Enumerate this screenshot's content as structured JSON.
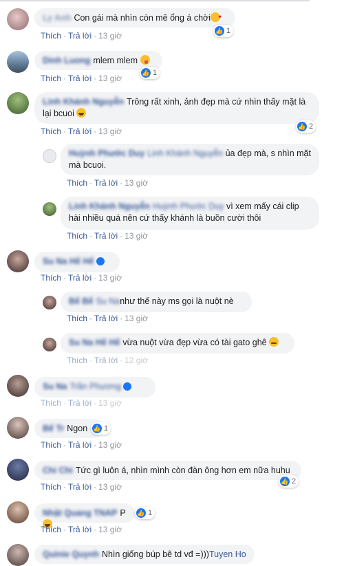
{
  "actions": {
    "like": "Thích",
    "reply": "Trả lời",
    "sep": "·"
  },
  "comments": [
    {
      "author": "Ly Anh",
      "text": "Con gái mà nhìn còn mê ổng á chời",
      "emoji": "love",
      "reactions": "1",
      "time": "13 giờ"
    },
    {
      "author": "Dinh Luong",
      "text": "mlem mlem",
      "emoji": "tongue",
      "reactions": "1",
      "time": "13 giờ"
    },
    {
      "author": "Linh Khánh Nguyễn",
      "text": "Trông rất xinh, ảnh đẹp mà cứ nhìn thấy mặt là lại bcuoi",
      "emoji": "laugh",
      "reactions": "2",
      "time": "13 giờ"
    },
    {
      "author": "Huỳnh Phước Duy",
      "mention": "Linh Khánh Nguyễn",
      "text": "ủa đẹp mà, s nhìn mặt mà bcuoi.",
      "time": "13 giờ"
    },
    {
      "author": "Linh Khánh Nguyễn",
      "mention": "Huỳnh Phước Duy",
      "text": "vì xem mấy cái clip hài nhiều quá nên cứ thấy khánh là buồn cười thôi",
      "time": "13 giờ"
    },
    {
      "author": "Su Na Hế Hế",
      "text": "",
      "time": "13 giờ"
    },
    {
      "author": "Bế Bế",
      "mention": "Su Na",
      "text": "như thế này ms gọi là nuột nè",
      "time": "13 giờ"
    },
    {
      "author": "Su Na Hế Hế",
      "text": "vừa nuột vừa đẹp vừa có tài gato ghê",
      "emoji": "grin",
      "time": "12 giờ"
    },
    {
      "author": "Su Na",
      "mention": "Trần Phương",
      "text": "",
      "time": "13 giờ"
    },
    {
      "author": "Bế Tr",
      "text": "Ngon",
      "reactions": "1",
      "time": "13 giờ"
    },
    {
      "author": "Chi Chi",
      "text": "Tức gì luôn á, nhìn mình còn đàn ông hơn em nữa huhu",
      "reactions": "2",
      "time": "13 giờ"
    },
    {
      "author": "Nhật Quang TNAP",
      "text": "P",
      "emoji": "laugh",
      "reactions": "1",
      "time": "13 giờ"
    },
    {
      "author": "Quinie Quynh",
      "text": "Nhìn giống búp bê td vđ =)))",
      "mention_after": "Tuyen Ho",
      "time": ""
    }
  ],
  "colors": {
    "link": "#385898",
    "bubble": "#f2f3f5",
    "like": "#1877f2",
    "meta": "#90949c"
  }
}
